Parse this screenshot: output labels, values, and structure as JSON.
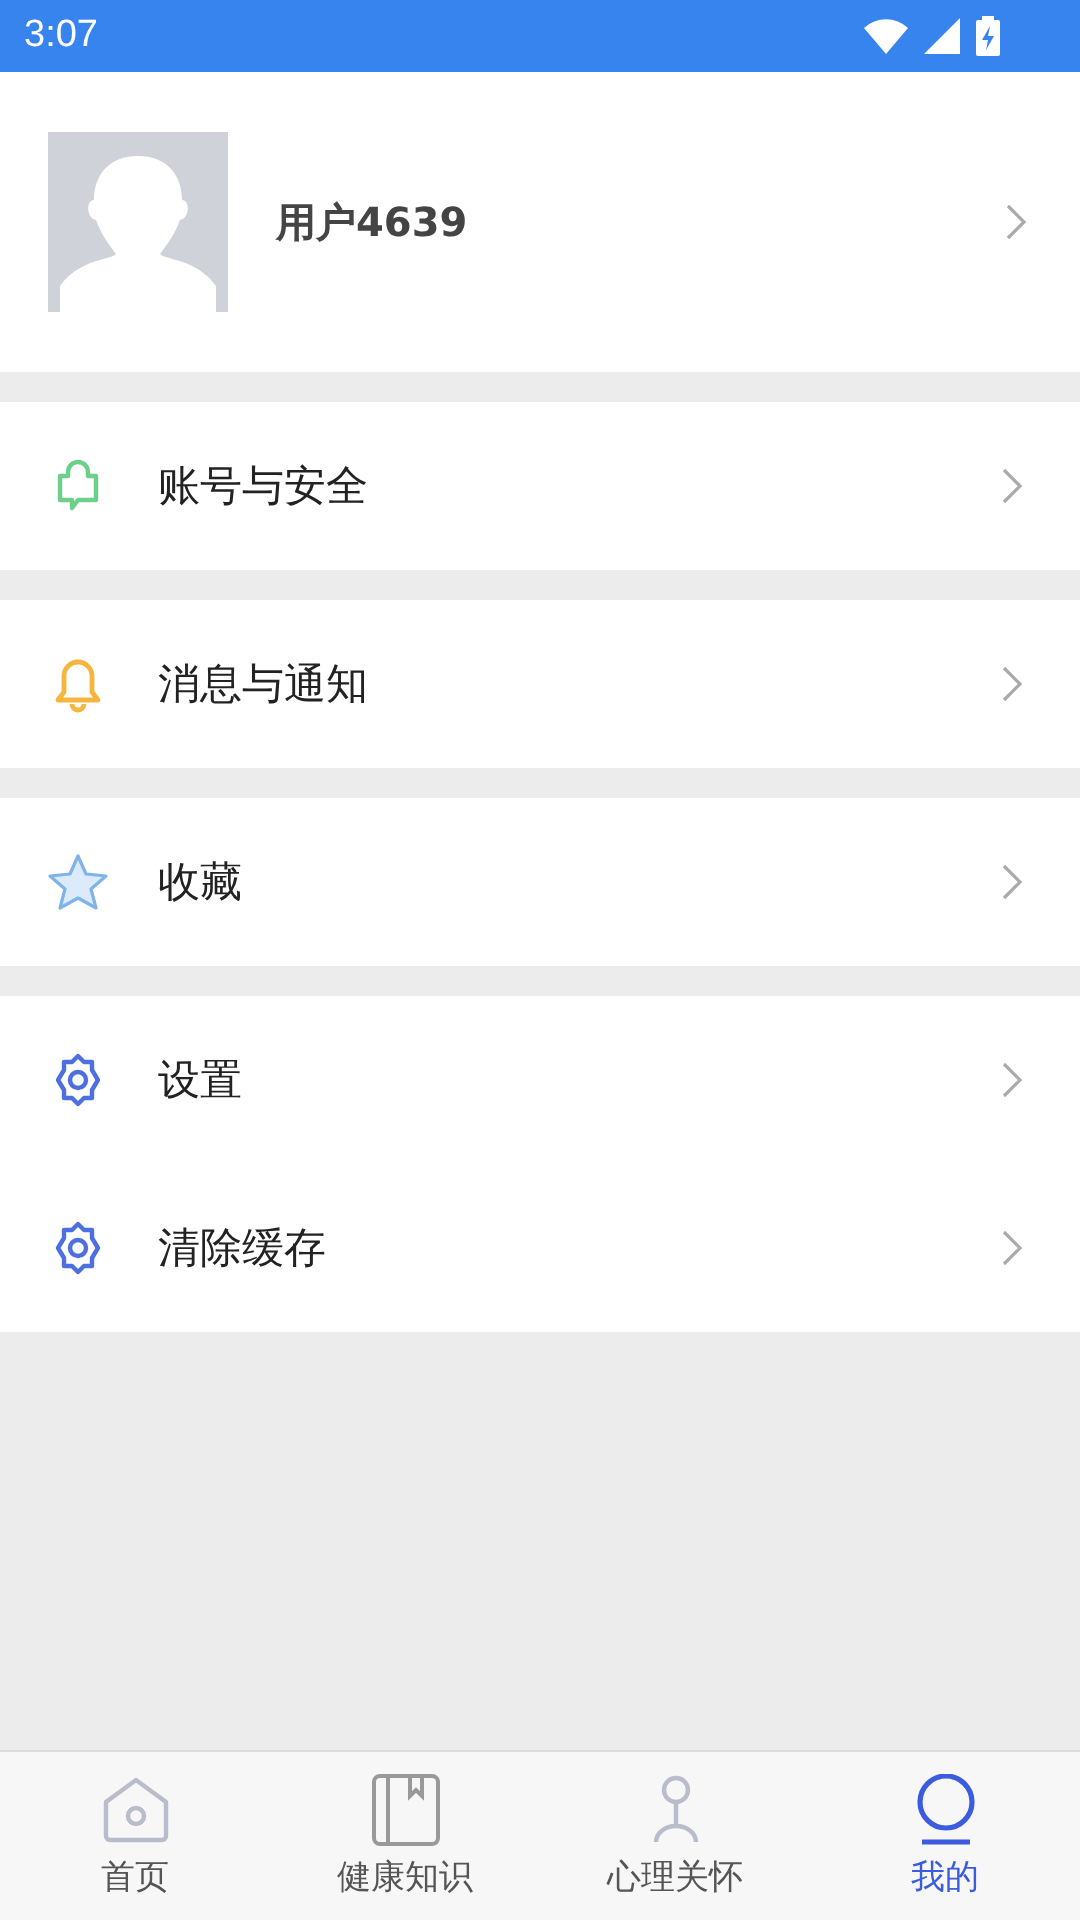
{
  "status_bar": {
    "time": "3:07"
  },
  "profile": {
    "username": "用户4639"
  },
  "menu_groups": [
    [
      {
        "label": "账号与安全",
        "kind": "shield"
      }
    ],
    [
      {
        "label": "消息与通知",
        "kind": "bell"
      }
    ],
    [
      {
        "label": "收藏",
        "kind": "star"
      }
    ],
    [
      {
        "label": "设置",
        "kind": "gear"
      },
      {
        "label": "清除缓存",
        "kind": "gear"
      }
    ]
  ],
  "tabs": [
    {
      "label": "首页",
      "kind": "home",
      "selected": false
    },
    {
      "label": "健康知识",
      "kind": "book",
      "selected": false
    },
    {
      "label": "心理关怀",
      "kind": "person",
      "selected": false
    },
    {
      "label": "我的",
      "kind": "user",
      "selected": true
    }
  ]
}
